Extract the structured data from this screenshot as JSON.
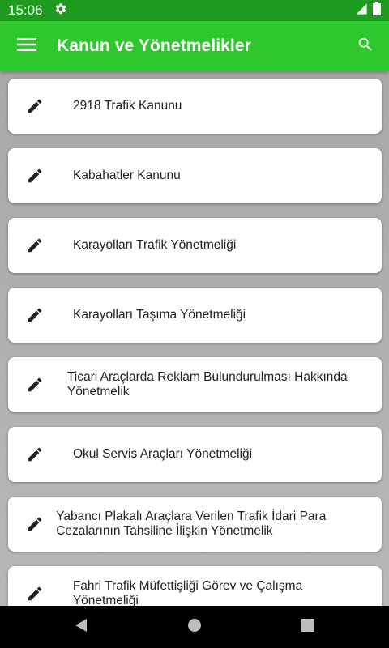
{
  "status_bar": {
    "time": "15:06",
    "icons": [
      "settings-icon",
      "signal-icon",
      "battery-icon"
    ]
  },
  "app_bar": {
    "title": "Kanun ve Yönetmelikler",
    "icons": [
      "menu-icon",
      "search-icon"
    ],
    "background": "#2ec82e",
    "status_background": "#1e9b1e"
  },
  "items": [
    {
      "label": "2918 Trafik Kanunu",
      "icon": "edit-icon"
    },
    {
      "label": "Kabahatler Kanunu",
      "icon": "edit-icon"
    },
    {
      "label": "Karayolları Trafik Yönetmeliği",
      "icon": "edit-icon"
    },
    {
      "label": "Karayolları Taşıma Yönetmeliği",
      "icon": "edit-icon"
    },
    {
      "label": "Ticari Araçlarda Reklam Bulundurulması Hakkında Yönetmelik",
      "icon": "edit-icon"
    },
    {
      "label": "Okul Servis Araçları Yönetmeliği",
      "icon": "edit-icon"
    },
    {
      "label": "Yabancı Plakalı Araçlara Verilen Trafik İdari Para Cezalarının Tahsiline İlişkin Yönetmelik",
      "icon": "edit-icon"
    },
    {
      "label": "Fahri Trafik Müfettişliği Görev ve Çalışma Yönetmeliği",
      "icon": "edit-icon"
    }
  ],
  "nav_bar": {
    "icons": [
      "back-icon",
      "home-icon",
      "recents-icon"
    ]
  }
}
